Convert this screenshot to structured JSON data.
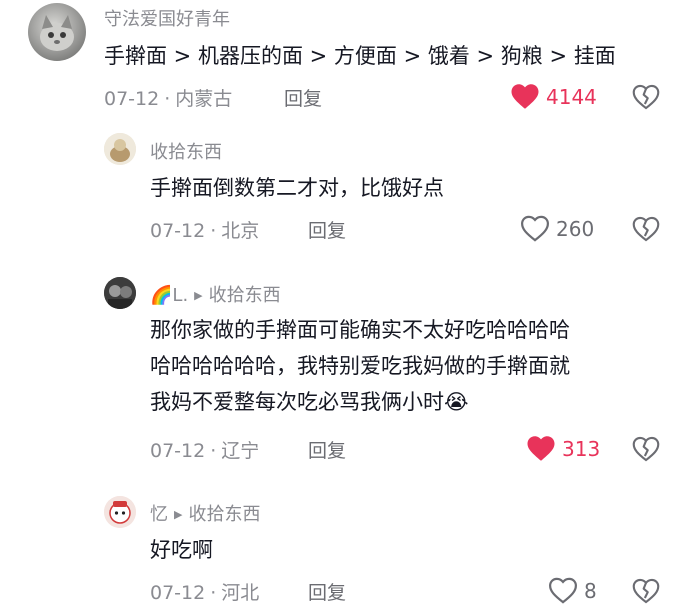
{
  "comments": [
    {
      "username": "守法爱国好青年",
      "reply_to": "",
      "text_lines": [
        "手擀面 > 机器压的面 > 方便面 > 饿着 > 狗粮 > 挂面"
      ],
      "date": "07-12",
      "location": "内蒙古",
      "reply_label": "回复",
      "likes": "4144",
      "liked": true
    },
    {
      "username": "收拾东西",
      "reply_to": "",
      "text_lines": [
        "手擀面倒数第二才对，比饿好点"
      ],
      "date": "07-12",
      "location": "北京",
      "reply_label": "回复",
      "likes": "260",
      "liked": false
    },
    {
      "username": "🌈L.",
      "reply_to": "收拾东西",
      "text_lines": [
        "那你家做的手擀面可能确实不太好吃哈哈哈哈",
        "哈哈哈哈哈哈，我特别爱吃我妈做的手擀面就",
        "我妈不爱整每次吃必骂我俩小时😭"
      ],
      "date": "07-12",
      "location": "辽宁",
      "reply_label": "回复",
      "likes": "313",
      "liked": true
    },
    {
      "username": "忆",
      "reply_to": "收拾东西",
      "text_lines": [
        "好吃啊"
      ],
      "date": "07-12",
      "location": "河北",
      "reply_label": "回复",
      "likes": "8",
      "liked": false
    }
  ],
  "colors": {
    "like_active": "#e8335a",
    "meta_gray": "#8a8b91",
    "text": "#161823"
  },
  "icons": {
    "like": "heart-icon",
    "dislike": "broken-heart-icon",
    "reply_arrow": "triangle-right-icon"
  }
}
